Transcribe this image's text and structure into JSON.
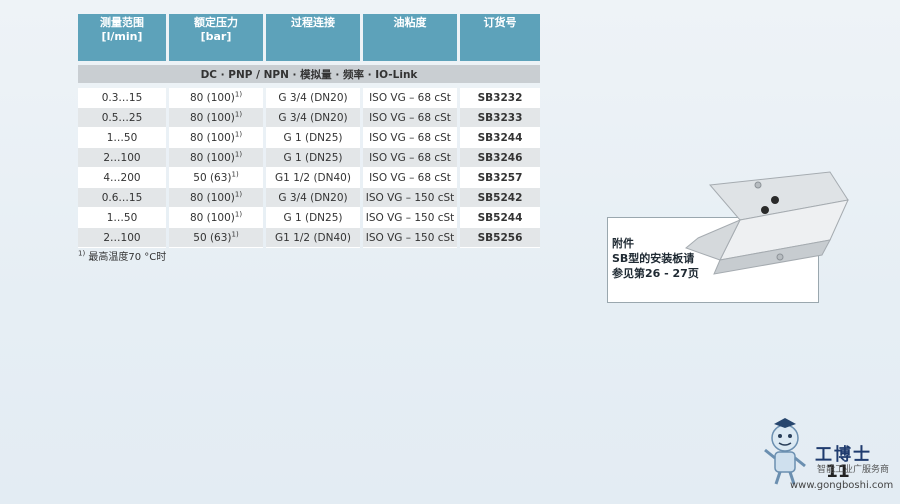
{
  "table": {
    "headers": [
      {
        "line1": "测量范围",
        "line2": "[l/min]"
      },
      {
        "line1": "额定压力",
        "line2": "[bar]"
      },
      {
        "line1": "过程连接",
        "line2": ""
      },
      {
        "line1": "油粘度",
        "line2": ""
      },
      {
        "line1": "订货号",
        "line2": ""
      }
    ],
    "section_title": "DC · PNP / NPN · 模拟量 · 频率 · IO-Link",
    "rows": [
      {
        "range": "0.3…15",
        "pressure": "80 (100)",
        "sup": "1)",
        "connection": "G 3/4 (DN20)",
        "viscosity": "ISO VG – 68 cSt",
        "order": "SB3232"
      },
      {
        "range": "0.5…25",
        "pressure": "80 (100)",
        "sup": "1)",
        "connection": "G 3/4 (DN20)",
        "viscosity": "ISO VG – 68 cSt",
        "order": "SB3233"
      },
      {
        "range": "1…50",
        "pressure": "80 (100)",
        "sup": "1)",
        "connection": "G 1 (DN25)",
        "viscosity": "ISO VG – 68 cSt",
        "order": "SB3244"
      },
      {
        "range": "2…100",
        "pressure": "80 (100)",
        "sup": "1)",
        "connection": "G 1 (DN25)",
        "viscosity": "ISO VG – 68 cSt",
        "order": "SB3246"
      },
      {
        "range": "4…200",
        "pressure": "50 (63)",
        "sup": "1)",
        "connection": "G1 1/2 (DN40)",
        "viscosity": "ISO VG – 68 cSt",
        "order": "SB3257"
      },
      {
        "range": "0.6…15",
        "pressure": "80 (100)",
        "sup": "1)",
        "connection": "G 3/4 (DN20)",
        "viscosity": "ISO VG – 150 cSt",
        "order": "SB5242"
      },
      {
        "range": "1…50",
        "pressure": "80 (100)",
        "sup": "1)",
        "connection": "G 1 (DN25)",
        "viscosity": "ISO VG – 150 cSt",
        "order": "SB5244"
      },
      {
        "range": "2…100",
        "pressure": "50 (63)",
        "sup": "1)",
        "connection": "G1 1/2 (DN40)",
        "viscosity": "ISO VG – 150 cSt",
        "order": "SB5256"
      }
    ]
  },
  "footnote": {
    "marker": "1)",
    "text": "最高温度70 °C时"
  },
  "callout": {
    "line1": "附件",
    "line2": "SB型的安装板请",
    "line3": "参见第26 - 27页"
  },
  "page_number": "11",
  "watermark": {
    "title": "工博士",
    "subtitle": "智能工业广服务商",
    "url": "www.gongboshi.com"
  }
}
